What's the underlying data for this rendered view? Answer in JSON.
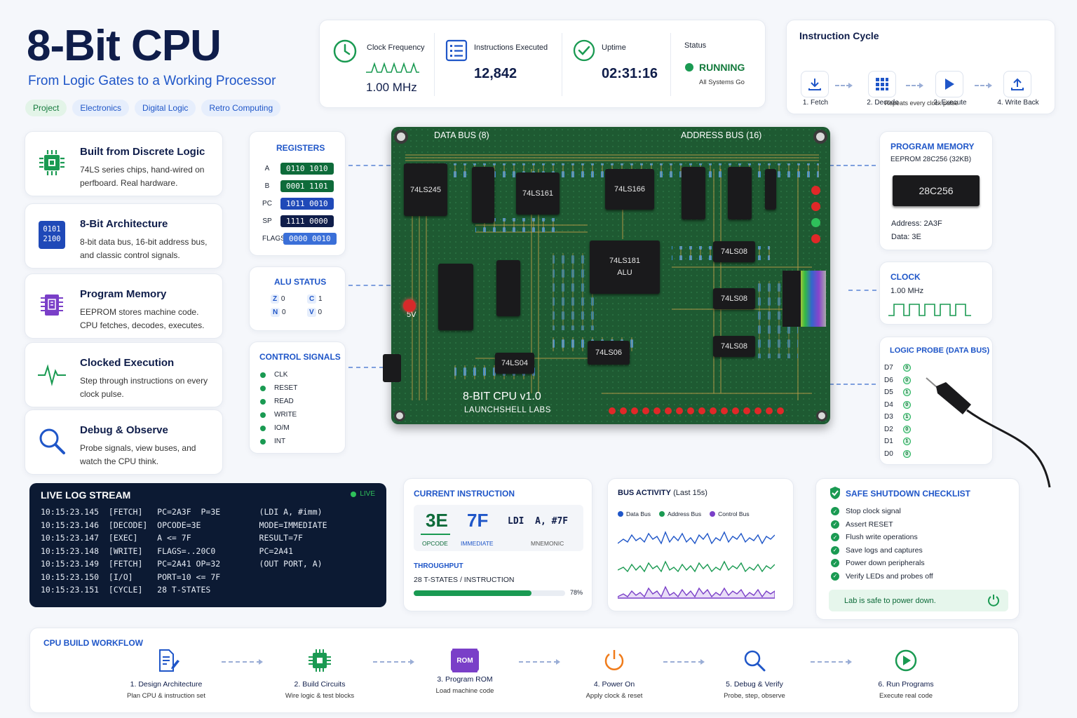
{
  "header": {
    "title": "8-Bit CPU",
    "subtitle": "From Logic Gates to a Working Processor",
    "tags": [
      "Project",
      "Electronics",
      "Digital Logic",
      "Retro Computing"
    ]
  },
  "stats": {
    "clock_label": "Clock Frequency",
    "clock_value": "1.00 MHz",
    "instr_label": "Instructions Executed",
    "instr_value": "12,842",
    "uptime_label": "Uptime",
    "uptime_value": "02:31:16",
    "status_label": "Status",
    "status_value": "RUNNING",
    "status_sub": "All Systems Go"
  },
  "cycle": {
    "title": "Instruction Cycle",
    "steps": [
      "1. Fetch",
      "2. Decode",
      "3. Execute",
      "4. Write Back"
    ],
    "note": "Repeats every clock pulse"
  },
  "features": [
    {
      "title": "Built from Discrete Logic",
      "desc": "74LS series chips, hand-wired on perfboard. Real hardware.",
      "icon": "chip-icon"
    },
    {
      "title": "8-Bit Architecture",
      "desc": "8-bit data bus, 16-bit address bus, and classic control signals.",
      "icon": "binary-icon",
      "icon_text": "0101 2100"
    },
    {
      "title": "Program Memory",
      "desc": "EEPROM stores machine code. CPU fetches, decodes, executes.",
      "icon": "memory-icon"
    },
    {
      "title": "Clocked Execution",
      "desc": "Step through instructions on every clock pulse.",
      "icon": "pulse-icon"
    },
    {
      "title": "Debug & Observe",
      "desc": "Probe signals, view buses, and watch the CPU think.",
      "icon": "magnifier-icon"
    }
  ],
  "registers": {
    "title": "REGISTERS",
    "items": [
      {
        "name": "A",
        "value": "0110 1010",
        "color": "#0e6b3a"
      },
      {
        "name": "B",
        "value": "0001 1101",
        "color": "#0e6b3a"
      },
      {
        "name": "PC",
        "value": "1011 0010",
        "color": "#1f49b8"
      },
      {
        "name": "SP",
        "value": "1111 0000",
        "color": "#0f1d4a"
      },
      {
        "name": "FLAGS",
        "value": "0000 0010",
        "color": "#3a6fd8"
      }
    ]
  },
  "alu": {
    "title": "ALU STATUS",
    "flags": [
      {
        "name": "Z",
        "value": "0"
      },
      {
        "name": "C",
        "value": "1"
      },
      {
        "name": "N",
        "value": "0"
      },
      {
        "name": "V",
        "value": "0"
      }
    ]
  },
  "control": {
    "title": "CONTROL SIGNALS",
    "signals": [
      "CLK",
      "RESET",
      "READ",
      "WRITE",
      "IO/M",
      "INT"
    ]
  },
  "board": {
    "data_bus": "DATA BUS (8)",
    "address_bus": "ADDRESS BUS (16)",
    "name": "8-BIT CPU v1.0",
    "maker": "LAUNCHSHELL LABS",
    "chips": [
      "74LS245",
      "74LS161",
      "74LS166",
      "74LS181\nALU",
      "74LS08",
      "74LS08",
      "74LS08",
      "74LS04",
      "74LS06"
    ],
    "voltage": "5V"
  },
  "program_memory": {
    "title": "PROGRAM MEMORY",
    "chip_desc": "EEPROM 28C256 (32KB)",
    "chip": "28C256",
    "address": "Address:  2A3F",
    "data": "Data:  3E"
  },
  "clock": {
    "title": "CLOCK",
    "value": "1.00 MHz"
  },
  "probe": {
    "title": "LOGIC PROBE (DATA BUS)",
    "bits": [
      {
        "name": "D7",
        "value": "0"
      },
      {
        "name": "D6",
        "value": "0"
      },
      {
        "name": "D5",
        "value": "1"
      },
      {
        "name": "D4",
        "value": "0"
      },
      {
        "name": "D3",
        "value": "1"
      },
      {
        "name": "D2",
        "value": "0"
      },
      {
        "name": "D1",
        "value": "1"
      },
      {
        "name": "D0",
        "value": "0"
      }
    ]
  },
  "log": {
    "title": "LIVE LOG STREAM",
    "live": "LIVE",
    "lines": [
      "10:15:23.145  [FETCH]   PC=2A3F  P=3E        (LDI A, #imm)",
      "10:15:23.146  [DECODE]  OPCODE=3E            MODE=IMMEDIATE",
      "10:15:23.147  [EXEC]    A <= 7F              RESULT=7F",
      "10:15:23.148  [WRITE]   FLAGS=..20C0         PC=2A41",
      "10:15:23.149  [FETCH]   PC=2A41 OP=32        (OUT PORT, A)",
      "10:15:23.150  [I/O]     PORT=10 <= 7F",
      "10:15:23.151  [CYCLE]   28 T-STATES"
    ]
  },
  "current_instruction": {
    "title": "CURRENT INSTRUCTION",
    "opcode": "3E",
    "operand": "7F",
    "mnemonic": "LDI  A, #7F",
    "opcode_label": "OPCODE",
    "operand_label": "IMMEDIATE",
    "mnemonic_label": "MNEMONIC",
    "throughput_title": "THROUGHPUT",
    "throughput_value": "28 T-STATES / INSTRUCTION",
    "progress": 78,
    "progress_label": "78%"
  },
  "bus_activity": {
    "title": "BUS ACTIVITY",
    "title_sub": "(Last 15s)",
    "legend": [
      {
        "name": "Data Bus",
        "color": "#1f56c8"
      },
      {
        "name": "Address Bus",
        "color": "#1a9a52"
      },
      {
        "name": "Control Bus",
        "color": "#7a3fc8"
      }
    ]
  },
  "shutdown": {
    "title": "SAFE SHUTDOWN CHECKLIST",
    "items": [
      "Stop clock signal",
      "Assert RESET",
      "Flush write operations",
      "Save logs and captures",
      "Power down peripherals",
      "Verify LEDs and probes off"
    ],
    "footer": "Lab is safe to power down."
  },
  "workflow": {
    "title": "CPU BUILD WORKFLOW",
    "steps": [
      {
        "title": "1. Design Architecture",
        "sub": "Plan CPU & instruction set"
      },
      {
        "title": "2. Build Circuits",
        "sub": "Wire logic & test blocks"
      },
      {
        "title": "3. Program ROM",
        "sub": "Load machine code",
        "icon_text": "ROM"
      },
      {
        "title": "4. Power On",
        "sub": "Apply clock & reset"
      },
      {
        "title": "5. Debug & Verify",
        "sub": "Probe, step, observe"
      },
      {
        "title": "6. Run Programs",
        "sub": "Execute real code"
      }
    ]
  }
}
